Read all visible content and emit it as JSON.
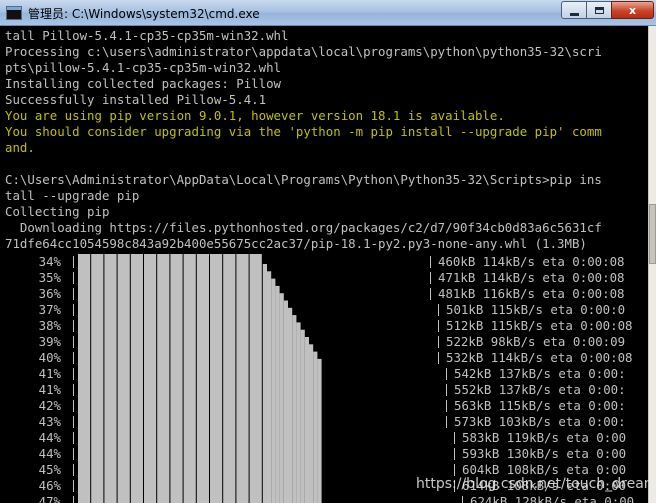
{
  "window": {
    "title": "管理员: C:\\Windows\\system32\\cmd.exe",
    "minimize_label": "",
    "maximize_label": "",
    "close_label": "x"
  },
  "console": {
    "lines": [
      {
        "text": "tall Pillow-5.4.1-cp35-cp35m-win32.whl",
        "color": "#c0c0c0"
      },
      {
        "text": "Processing c:\\users\\administrator\\appdata\\local\\programs\\python\\python35-32\\scri",
        "color": "#c0c0c0"
      },
      {
        "text": "pts\\pillow-5.4.1-cp35-cp35m-win32.whl",
        "color": "#c0c0c0"
      },
      {
        "text": "Installing collected packages: Pillow",
        "color": "#c0c0c0"
      },
      {
        "text": "Successfully installed Pillow-5.4.1",
        "color": "#c0c0c0"
      },
      {
        "text": "You are using pip version 9.0.1, however version 18.1 is available.",
        "color": "#c0c000"
      },
      {
        "text": "You should consider upgrading via the 'python -m pip install --upgrade pip' comm",
        "color": "#c0c000"
      },
      {
        "text": "and.",
        "color": "#c0c000"
      },
      {
        "text": "",
        "color": "#c0c0c0"
      },
      {
        "text": "C:\\Users\\Administrator\\AppData\\Local\\Programs\\Python\\Python35-32\\Scripts>pip ins",
        "color": "#c0c0c0"
      },
      {
        "text": "tall --upgrade pip",
        "color": "#c0c0c0"
      },
      {
        "text": "Collecting pip",
        "color": "#c0c0c0"
      },
      {
        "text": "  Downloading https://files.pythonhosted.org/packages/c2/d7/90f34cb0d83a6c5631cf",
        "color": "#c0c0c0"
      },
      {
        "text": "71dfe64cc1054598c843a92b400e55675cc2ac37/pip-18.1-py2.py3-none-any.whl (1.3MB)",
        "color": "#c0c0c0"
      }
    ],
    "progress_rows": [
      {
        "percent": "34%",
        "stats": "460kB 114kB/s eta 0:00:08"
      },
      {
        "percent": "35%",
        "stats": "471kB 114kB/s eta 0:00:08"
      },
      {
        "percent": "36%",
        "stats": "481kB 116kB/s eta 0:00:08"
      },
      {
        "percent": "37%",
        "stats": "501kB 115kB/s eta 0:00:0"
      },
      {
        "percent": "38%",
        "stats": "512kB 115kB/s eta 0:00:08"
      },
      {
        "percent": "39%",
        "stats": "522kB 98kB/s eta 0:00:09"
      },
      {
        "percent": "40%",
        "stats": "532kB 114kB/s eta 0:00:08"
      },
      {
        "percent": "41%",
        "stats": "542kB 137kB/s eta 0:00:"
      },
      {
        "percent": "41%",
        "stats": "552kB 137kB/s eta 0:00:"
      },
      {
        "percent": "42%",
        "stats": "563kB 115kB/s eta 0:00:"
      },
      {
        "percent": "43%",
        "stats": "573kB 103kB/s eta 0:00:"
      },
      {
        "percent": "44%",
        "stats": "583kB 119kB/s eta 0:00"
      },
      {
        "percent": "44%",
        "stats": "593kB 130kB/s eta 0:00"
      },
      {
        "percent": "45%",
        "stats": "604kB 108kB/s eta 0:00"
      },
      {
        "percent": "46%",
        "stats": "614kB 108kB/s eta 0:00"
      },
      {
        "percent": "47%",
        "stats": "624kB 128kB/s eta 0:00"
      }
    ]
  },
  "watermark": "https://blog.csdn.net/touch_dream",
  "colors": {
    "console_bg": "#000000",
    "console_text": "#c0c0c0",
    "warning_text": "#c0c000",
    "bar_fill": "#c0c0c0",
    "title_bar": "#a9c2e2",
    "close_button": "#c8452a"
  }
}
